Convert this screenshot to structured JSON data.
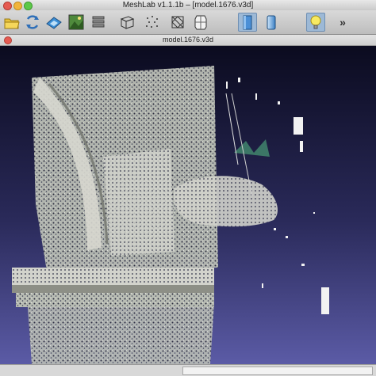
{
  "window": {
    "title": "MeshLab v1.1.1b – [model.1676.v3d]"
  },
  "document": {
    "tab_title": "model.1676.v3d"
  },
  "toolbar": {
    "items": [
      {
        "name": "open-icon"
      },
      {
        "name": "reload-icon"
      },
      {
        "name": "snapshot-icon"
      },
      {
        "name": "texture-icon"
      },
      {
        "name": "layers-icon"
      },
      {
        "name": "box-icon"
      },
      {
        "name": "points-icon"
      },
      {
        "name": "wireframe-icon"
      },
      {
        "name": "hiddenlines-icon"
      },
      {
        "name": "flat-icon"
      },
      {
        "name": "smooth-icon"
      },
      {
        "name": "lighting-icon"
      },
      {
        "name": "more-icon",
        "label": "»"
      }
    ],
    "accent": "#9db9d6"
  },
  "statusbar": {
    "text": ""
  }
}
